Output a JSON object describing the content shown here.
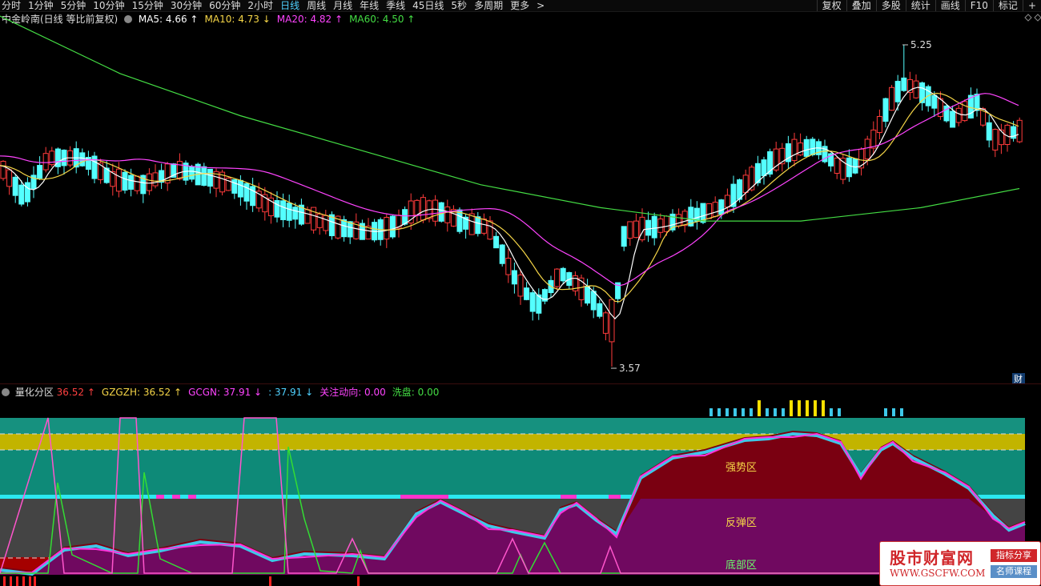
{
  "toolbar": {
    "periods": [
      "分时",
      "1分钟",
      "5分钟",
      "10分钟",
      "15分钟",
      "30分钟",
      "60分钟",
      "2小时",
      "日线",
      "周线",
      "月线",
      "年线",
      "季线",
      "45日线",
      "5秒",
      "多周期",
      "更多"
    ],
    "active_period": "日线",
    "more_arrow": ">",
    "right_buttons": [
      "复权",
      "叠加",
      "多股",
      "统计",
      "画线",
      "F10",
      "标记",
      "+"
    ]
  },
  "main_chart": {
    "title": "中金岭南(日线 等比前复权)",
    "ma": [
      {
        "label": "MA5: 4.66",
        "arrow": "↑",
        "color": "#ffffff"
      },
      {
        "label": "MA10: 4.73",
        "arrow": "↓",
        "color": "#f5d547"
      },
      {
        "label": "MA20: 4.82",
        "arrow": "↑",
        "color": "#ff44ff"
      },
      {
        "label": "MA60: 4.50",
        "arrow": "↑",
        "color": "#44dd44"
      }
    ],
    "high_label": "5.25",
    "low_label": "3.57",
    "fin_badge": "财",
    "up_color": "#ff3b3b",
    "down_color": "#54ffff"
  },
  "indicator": {
    "title": "量化分区",
    "values": [
      {
        "label": "36.52",
        "arrow": "↑",
        "color": "#ff4040"
      },
      {
        "label": "GZGZH: 36.52",
        "arrow": "↑",
        "color": "#f5d547"
      },
      {
        "label": "GCGN: 37.91",
        "arrow": "↓",
        "color": "#ff44ff"
      },
      {
        "label": ": 37.91",
        "arrow": "↓",
        "color": "#4fd1ff"
      },
      {
        "label": "关注动向: 0.00",
        "arrow": "",
        "color": "#ff44ff"
      },
      {
        "label": "洗盘: 0.00",
        "arrow": "",
        "color": "#44dd44"
      }
    ],
    "zones": [
      "强势区",
      "反弹区",
      "底部区"
    ],
    "zone_colors": {
      "top": "#16917f",
      "yellow": "#c2b400",
      "strong": "#0e8a78",
      "rebound": "#444444",
      "bottom": "#a50000"
    }
  },
  "watermark": {
    "title": "股市财富网",
    "url": "WWW.GSCFW.COM",
    "tag1": "指标分享",
    "tag2": "名师课程"
  }
}
